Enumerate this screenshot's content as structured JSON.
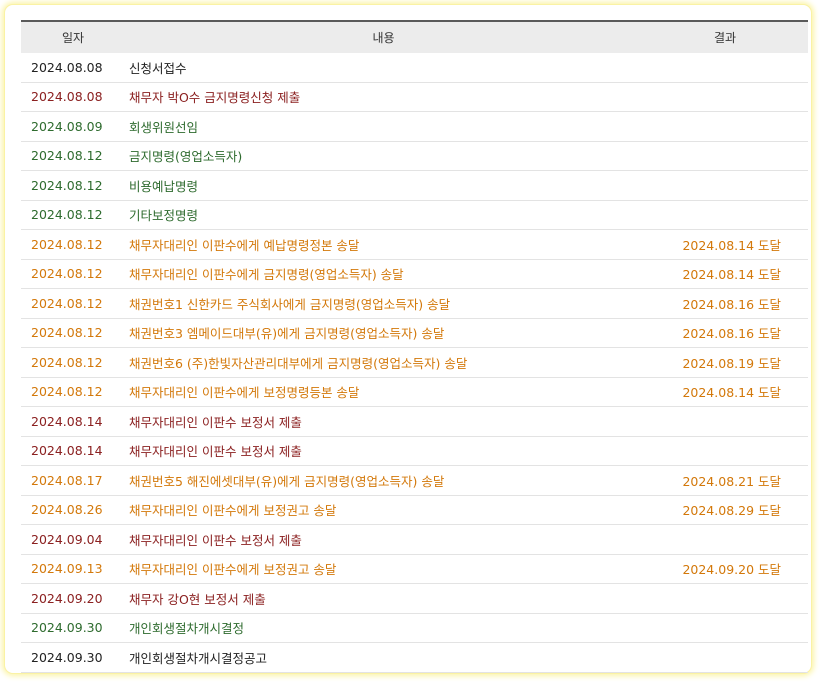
{
  "columns": {
    "date": "일자",
    "content": "내용",
    "result": "결과"
  },
  "colors": {
    "dark": "#222222",
    "brown": "#8b2020",
    "green": "#2e6b2e",
    "orange": "#d3780a",
    "header_bg": "#ececec",
    "frame_glow": "#fbf4a8"
  },
  "rows": [
    {
      "date": "2024.08.08",
      "content": "신청서접수",
      "result": "",
      "tone": "dark"
    },
    {
      "date": "2024.08.08",
      "content": "채무자 박O수 금지명령신청 제출",
      "result": "",
      "tone": "brown"
    },
    {
      "date": "2024.08.09",
      "content": "회생위원선임",
      "result": "",
      "tone": "green"
    },
    {
      "date": "2024.08.12",
      "content": "금지명령(영업소득자)",
      "result": "",
      "tone": "green"
    },
    {
      "date": "2024.08.12",
      "content": "비용예납명령",
      "result": "",
      "tone": "green"
    },
    {
      "date": "2024.08.12",
      "content": "기타보정명령",
      "result": "",
      "tone": "green"
    },
    {
      "date": "2024.08.12",
      "content": "채무자대리인 이판수에게 예납명령정본 송달",
      "result": "2024.08.14 도달",
      "tone": "orange"
    },
    {
      "date": "2024.08.12",
      "content": "채무자대리인 이판수에게 금지명령(영업소득자) 송달",
      "result": "2024.08.14 도달",
      "tone": "orange"
    },
    {
      "date": "2024.08.12",
      "content": "채권번호1 신한카드 주식회사에게 금지명령(영업소득자) 송달",
      "result": "2024.08.16 도달",
      "tone": "orange"
    },
    {
      "date": "2024.08.12",
      "content": "채권번호3 엠메이드대부(유)에게 금지명령(영업소득자) 송달",
      "result": "2024.08.16 도달",
      "tone": "orange"
    },
    {
      "date": "2024.08.12",
      "content": "채권번호6 (주)한빛자산관리대부에게 금지명령(영업소득자) 송달",
      "result": "2024.08.19 도달",
      "tone": "orange"
    },
    {
      "date": "2024.08.12",
      "content": "채무자대리인 이판수에게 보정명령등본 송달",
      "result": "2024.08.14 도달",
      "tone": "orange"
    },
    {
      "date": "2024.08.14",
      "content": "채무자대리인 이판수 보정서 제출",
      "result": "",
      "tone": "brown"
    },
    {
      "date": "2024.08.14",
      "content": "채무자대리인 이판수 보정서 제출",
      "result": "",
      "tone": "brown"
    },
    {
      "date": "2024.08.17",
      "content": "채권번호5 해진에셋대부(유)에게 금지명령(영업소득자) 송달",
      "result": "2024.08.21 도달",
      "tone": "orange"
    },
    {
      "date": "2024.08.26",
      "content": "채무자대리인 이판수에게 보정권고 송달",
      "result": "2024.08.29 도달",
      "tone": "orange"
    },
    {
      "date": "2024.09.04",
      "content": "채무자대리인 이판수 보정서 제출",
      "result": "",
      "tone": "brown"
    },
    {
      "date": "2024.09.13",
      "content": "채무자대리인 이판수에게 보정권고 송달",
      "result": "2024.09.20 도달",
      "tone": "orange"
    },
    {
      "date": "2024.09.20",
      "content": "채무자 강O현 보정서 제출",
      "result": "",
      "tone": "brown"
    },
    {
      "date": "2024.09.30",
      "content": "개인회생절차개시결정",
      "result": "",
      "tone": "green"
    },
    {
      "date": "2024.09.30",
      "content": "개인회생절차개시결정공고",
      "result": "",
      "tone": "dark"
    }
  ]
}
